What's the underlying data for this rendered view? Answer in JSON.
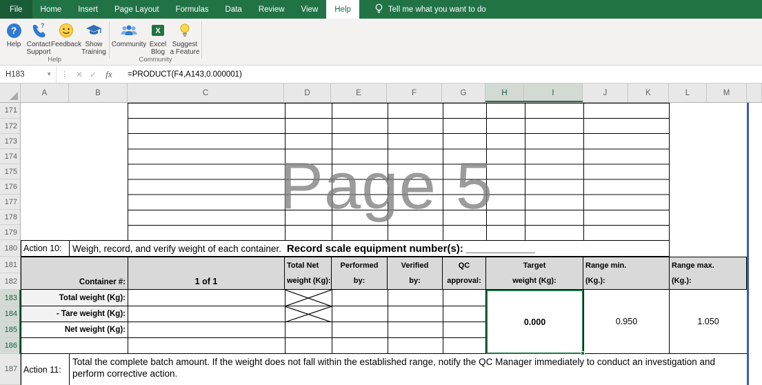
{
  "ribbon": {
    "tabs": [
      "File",
      "Home",
      "Insert",
      "Page Layout",
      "Formulas",
      "Data",
      "Review",
      "View",
      "Help"
    ],
    "tell_me": "Tell me what you want to do",
    "help_group": {
      "label": "Help",
      "help_button": "Help",
      "contact_line1": "Contact",
      "contact_line2": "Support",
      "feedback_button": "Feedback",
      "training_line1": "Show",
      "training_line2": "Training"
    },
    "community_group": {
      "label": "Community",
      "community_button": "Community",
      "blog_line1": "Excel",
      "blog_line2": "Blog",
      "suggest_line1": "Suggest",
      "suggest_line2": "a Feature"
    }
  },
  "formula_bar": {
    "name_box": "H183",
    "formula": "=PRODUCT(F4,A143,0.000001)"
  },
  "grid": {
    "columns": [
      "A",
      "B",
      "C",
      "D",
      "E",
      "F",
      "G",
      "H",
      "I",
      "J",
      "K",
      "L",
      "M"
    ],
    "rows": [
      "171",
      "172",
      "173",
      "174",
      "175",
      "176",
      "177",
      "178",
      "179",
      "180",
      "181",
      "182",
      "183",
      "184",
      "185",
      "186",
      "187"
    ],
    "watermark": "Page 5"
  },
  "sheet": {
    "action10": {
      "label": "Action 10:",
      "text": "Weigh, record, and verify weight of each container.",
      "bold_text": "Record scale equipment number(s):",
      "blank": "____________"
    },
    "table_header": {
      "container_label": "Container #:",
      "container_value": "1 of 1",
      "total_net_line1": "Total Net",
      "total_net_line2": "weight (Kg):",
      "performed_line1": "Performed",
      "performed_line2": "by:",
      "verified_line1": "Verified",
      "verified_line2": "by:",
      "qc_line1": "QC",
      "qc_line2": "approval:",
      "target_line1": "Target",
      "target_line2": "weight (Kg):",
      "range_min_line1": "Range min.",
      "range_min_line2": "(Kg.):",
      "range_max_line1": "Range max.",
      "range_max_line2": "(Kg.):"
    },
    "body": {
      "total_weight_label": "Total weight (Kg):",
      "tare_weight_label": "- Tare weight (Kg):",
      "net_weight_label": "Net weight (Kg):",
      "target_value": "0.000",
      "range_min_value": "0.950",
      "range_max_value": "1.050"
    },
    "action11": {
      "label": "Action 11:",
      "text": "Total the complete batch amount.  If the weight does not fall within the established range, notify the QC Manager immediately to conduct an investigation and perform corrective action."
    }
  }
}
